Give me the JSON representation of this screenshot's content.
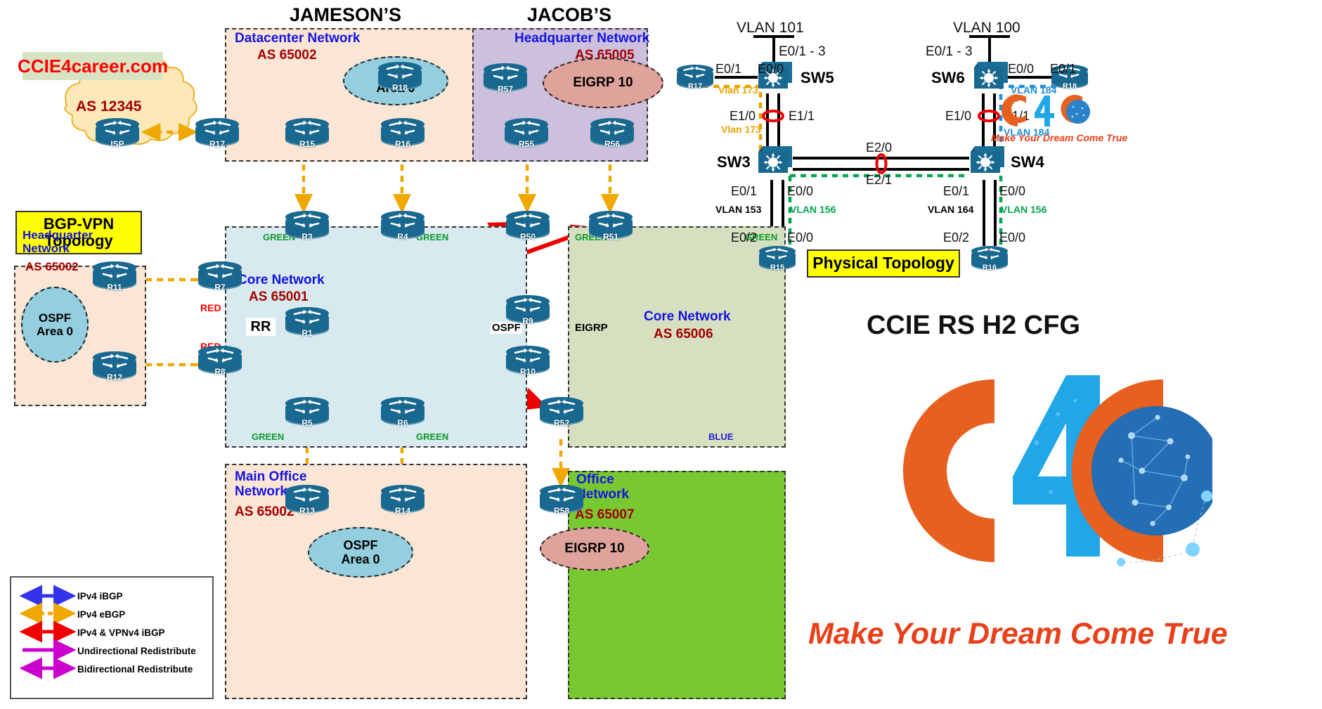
{
  "headers": {
    "jamesons": "JAMESON’S",
    "jacobs": "JACOB’S"
  },
  "site_url": "CCIE4career.com",
  "banners": {
    "bgp_vpn": "BGP-VPN\nTopology",
    "physical": "Physical Topology",
    "cfg_title": "CCIE RS H2 CFG",
    "tagline": "Make Your Dream Come True",
    "logo_tagline": "Make Your Dream Come True"
  },
  "zones": [
    {
      "id": "isp-cloud",
      "as": "AS 12345",
      "title": ""
    },
    {
      "id": "datacenter",
      "title": "Datacenter Network",
      "as": "AS 65002"
    },
    {
      "id": "hq-jacobs",
      "title": "Headquarter Network",
      "as": "AS 65005"
    },
    {
      "id": "hq-left",
      "title": "Headquarter\nNetwork",
      "as": "AS 65002"
    },
    {
      "id": "core-65001",
      "title": "Core Network",
      "as": "AS 65001"
    },
    {
      "id": "core-65006",
      "title": "Core Network",
      "as": "AS 65006"
    },
    {
      "id": "main-office",
      "title": "Main Office\nNetwork",
      "as": "AS 65002"
    },
    {
      "id": "office",
      "title": "Office\nNetwork",
      "as": "AS 65007"
    }
  ],
  "routers": {
    "isp": "ISP",
    "r17": "R17",
    "r18": "R18",
    "r15": "R15",
    "r16": "R16",
    "r57": "R57",
    "r55": "R55",
    "r56": "R56",
    "r11": "R11",
    "r12": "R12",
    "r3": "R3",
    "r4": "R4",
    "r5": "R5",
    "r6": "R6",
    "r7": "R7",
    "r8": "R8",
    "r1": "R1",
    "r9": "R9",
    "r10": "R10",
    "r13": "R13",
    "r14": "R14",
    "r50": "R50",
    "r51": "R51",
    "r52": "R52",
    "r58": "R58",
    "p_r17": "R17",
    "p_r18": "R18",
    "p_r15": "R15",
    "p_r16": "R16"
  },
  "protocol_clouds": {
    "ospf_dc": "OSPF\nArea 0",
    "eigrp_jacobs": "EIGRP 10",
    "ospf_hq_left": "OSPF\nArea 0",
    "ospf_main_office": "OSPF\nArea 0",
    "eigrp_office": "EIGRP 10"
  },
  "marker_labels": {
    "rr": "RR",
    "red_r7": "RED",
    "red_r8": "RED",
    "green_r3": "GREEN",
    "green_r4": "GREEN",
    "green_r5": "GREEN",
    "green_r6": "GREEN",
    "green_r50": "GREEN",
    "green_r51": "GREEN",
    "blue_r52": "BLUE",
    "ospf_mid": "OSPF",
    "eigrp_mid": "EIGRP"
  },
  "legend": {
    "items": [
      {
        "label": "IPv4 iBGP",
        "color": "#3333ee",
        "style": "solid",
        "heads": "both"
      },
      {
        "label": "IPv4 eBGP",
        "color": "#f0a800",
        "style": "dashed",
        "heads": "both"
      },
      {
        "label": "IPv4 & VPNv4 iBGP",
        "color": "#ee0000",
        "style": "solid",
        "heads": "both"
      },
      {
        "label": "Undirectional Redistribute",
        "color": "#cc00cc",
        "style": "solid",
        "heads": "right"
      },
      {
        "label": "Bidirectional Redistribute",
        "color": "#cc00cc",
        "style": "solid",
        "heads": "both"
      }
    ]
  },
  "physical_topology": {
    "switches": {
      "sw3": "SW3",
      "sw4": "SW4",
      "sw5": "SW5",
      "sw6": "SW6"
    },
    "vlan_trunks": {
      "left": "VLAN 101",
      "right": "VLAN 100"
    },
    "port_labels": {
      "sw5_uplink": "E0/1 - 3",
      "sw6_uplink": "E0/1 - 3",
      "r17_e01": "E0/1",
      "sw5_e00": "E0/0",
      "sw6_e00": "E0/0",
      "r18_e01": "E0/1",
      "sw5_e10": "E1/0",
      "sw5_e11": "E1/1",
      "sw6_e10": "E1/0",
      "sw6_e11": "E1/1",
      "sw3_sw4_e20": "E2/0",
      "sw3_sw4_e21": "E2/1",
      "sw3_e01": "E0/1",
      "sw3_e00": "E0/0",
      "sw4_e01": "E0/1",
      "sw4_e00": "E0/0",
      "r15_e02": "E0/2",
      "r15_e00": "E0/0",
      "r16_e02": "E0/2",
      "r16_e00": "E0/0"
    },
    "vlan_labels": {
      "vlan173_top": "Vlan 173",
      "vlan173_bottom": "Vlan 173",
      "vlan184_top": "VLAN 184",
      "vlan184_bottom": "VLAN 184",
      "vlan153": "VLAN 153",
      "vlan156_left": "VLAN 156",
      "vlan164": "VLAN 164",
      "vlan156_right": "VLAN 156"
    }
  },
  "colors": {
    "ibgp": "#3333ee",
    "ebgp": "#f0a800",
    "vpnv4": "#ee0000",
    "redistribute": "#cc00cc",
    "zone_orange": "#fbe5d5",
    "zone_purple": "#ccc0dd",
    "zone_blue": "#d8eaf0",
    "zone_olive": "#d6e0c0",
    "zone_green": "#78c832",
    "switch_blue": "#19688f",
    "brand_orange": "#e8401a",
    "vlan_green": "#00a550",
    "vlan_cyan": "#1f8fd6",
    "vlan_orange": "#e8a200"
  }
}
